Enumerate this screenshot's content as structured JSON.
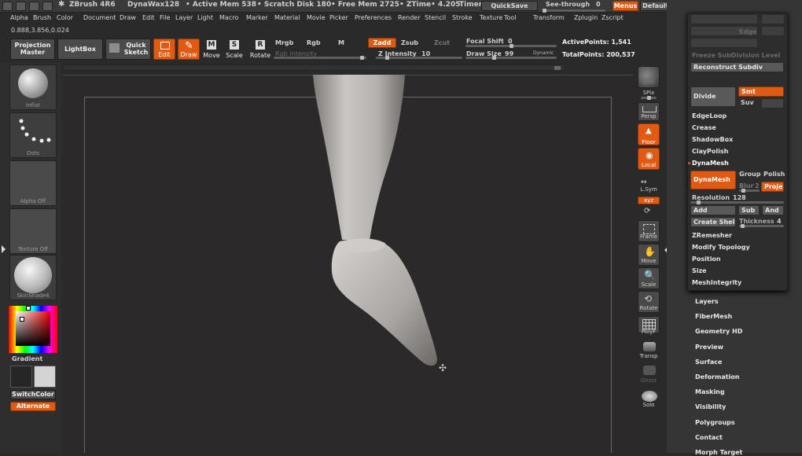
{
  "title_bar": {
    "app": "ZBrush 4R6",
    "doc": "DynaWax128",
    "active_mem": "• Active Mem 538",
    "scratch": "• Scratch Disk 180",
    "free_mem": "• Free Mem 2725",
    "ztime": "• ZTime• 4.205",
    "timer": "Timer",
    "quicksave": "QuickSave",
    "seethrough": "See-through",
    "seethrough_val": "0",
    "menus": "Menus",
    "script": "DefaultZScript"
  },
  "menu": [
    "Alpha",
    "Brush",
    "Color",
    "Document",
    "Draw",
    "Edit",
    "File",
    "Layer",
    "Light",
    "Macro",
    "Marker",
    "Material",
    "Movie",
    "Picker",
    "Preferences",
    "Render",
    "Stencil",
    "Stroke",
    "Texture",
    "Tool",
    "Transform",
    "Zplugin",
    "Zscript"
  ],
  "coords": "0.888,3.856,0.024",
  "toolbar": {
    "projection_master": "Projection Master",
    "lightbox": "LightBox",
    "quick_sketch": "Quick Sketch",
    "edit": "Edit",
    "draw": "Draw",
    "move": "Move",
    "scale": "Scale",
    "rotate": "Rotate",
    "mrgb": "Mrgb",
    "rgb": "Rgb",
    "m": "M",
    "zadd": "Zadd",
    "zsub": "Zsub",
    "zcut": "Zcut",
    "rgb_intensity": "Rgb Intensity",
    "z_intensity": "Z Intensity",
    "z_intensity_val": "10",
    "focal_shift": "Focal Shift",
    "focal_shift_val": "0",
    "draw_size": "Draw Size",
    "draw_size_val": "99",
    "dynamic": "Dynamic",
    "active_points": "ActivePoints: 1,541",
    "total_points": "TotalPoints: 200,537"
  },
  "left_shelf": {
    "inflat": "Inflat",
    "dots": "Dots",
    "alpha_off": "Alpha Off",
    "texture_off": "Texture Off",
    "material": "SkinShade4",
    "gradient": "Gradient",
    "switchcolor": "SwitchColor",
    "alternate": "Alternate"
  },
  "right_shelf": {
    "bpr": "BPR",
    "spix": "SPix",
    "persp": "Persp",
    "floor": "Floor",
    "local": "Local",
    "lsym": "L.Sym",
    "xyz": "xyz",
    "frame": "Frame",
    "move": "Move",
    "scale": "Scale",
    "rotate": "Rotate",
    "polyf": "PolyF",
    "transp": "Transp",
    "ghost": "Ghost",
    "solo": "Solo"
  },
  "geometry_panel": {
    "edge": "Edge",
    "freeze": "Freeze SubDivision Level",
    "reconstruct": "Reconstruct Subdiv",
    "divide": "Divide",
    "smt": "Smt",
    "suv": "Suv",
    "edgeloop": "EdgeLoop",
    "crease": "Crease",
    "shadowbox": "ShadowBox",
    "claypolish": "ClayPolish",
    "dynamesh_header": "DynaMesh",
    "dynamesh_btn": "DynaMesh",
    "group": "Group",
    "polish": "Polish",
    "blur": "Blur",
    "blur_val": "2",
    "proje": "Proje",
    "resolution": "Resolution",
    "resolution_val": "128",
    "add": "Add",
    "sub": "Sub",
    "and": "And",
    "create_shell": "Create Shell",
    "thickness": "Thickness",
    "thickness_val": "4",
    "zremesher": "ZRemesher",
    "modify_topology": "Modify Topology",
    "position": "Position",
    "size": "Size",
    "meshintegrity": "MeshIntegrity"
  },
  "tool_subpalettes": [
    "Layers",
    "FiberMesh",
    "Geometry HD",
    "Preview",
    "Surface",
    "Deformation",
    "Masking",
    "Visibility",
    "Polygroups",
    "Contact",
    "Morph Target"
  ],
  "colors": {
    "accent": "#e05a12",
    "bg": "#2a2a2a",
    "canvas": "#2b2929",
    "panel": "#353535"
  }
}
